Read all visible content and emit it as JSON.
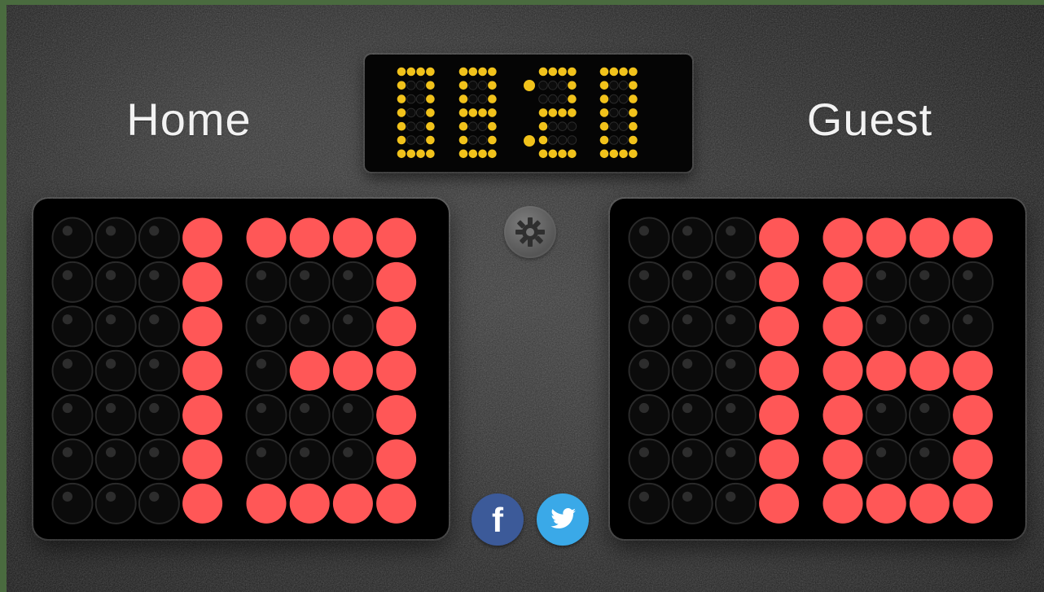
{
  "labels": {
    "home": "Home",
    "guest": "Guest"
  },
  "timer": {
    "display": "08:20",
    "digits": [
      "0",
      "8",
      "2",
      "0"
    ],
    "led_color": "#f1c21b"
  },
  "scores": {
    "home": {
      "display": "13",
      "digits": [
        "1",
        "3"
      ],
      "led_color": "#ff5757"
    },
    "guest": {
      "display": "16",
      "digits": [
        "1",
        "6"
      ],
      "led_color": "#ff5757"
    }
  },
  "controls": {
    "settings_icon": "gear-icon",
    "facebook_icon": "facebook-icon",
    "facebook_letter": "f",
    "twitter_icon": "twitter-icon"
  },
  "colors": {
    "background": "#252525",
    "panel": "#000000",
    "score_on": "#ff5757",
    "score_off": "#0b0b0b",
    "timer_on": "#f1c21b",
    "timer_off": "#0c0c0c",
    "facebook": "#3c5a99",
    "twitter": "#3aa9e8",
    "settings": "#666666"
  }
}
